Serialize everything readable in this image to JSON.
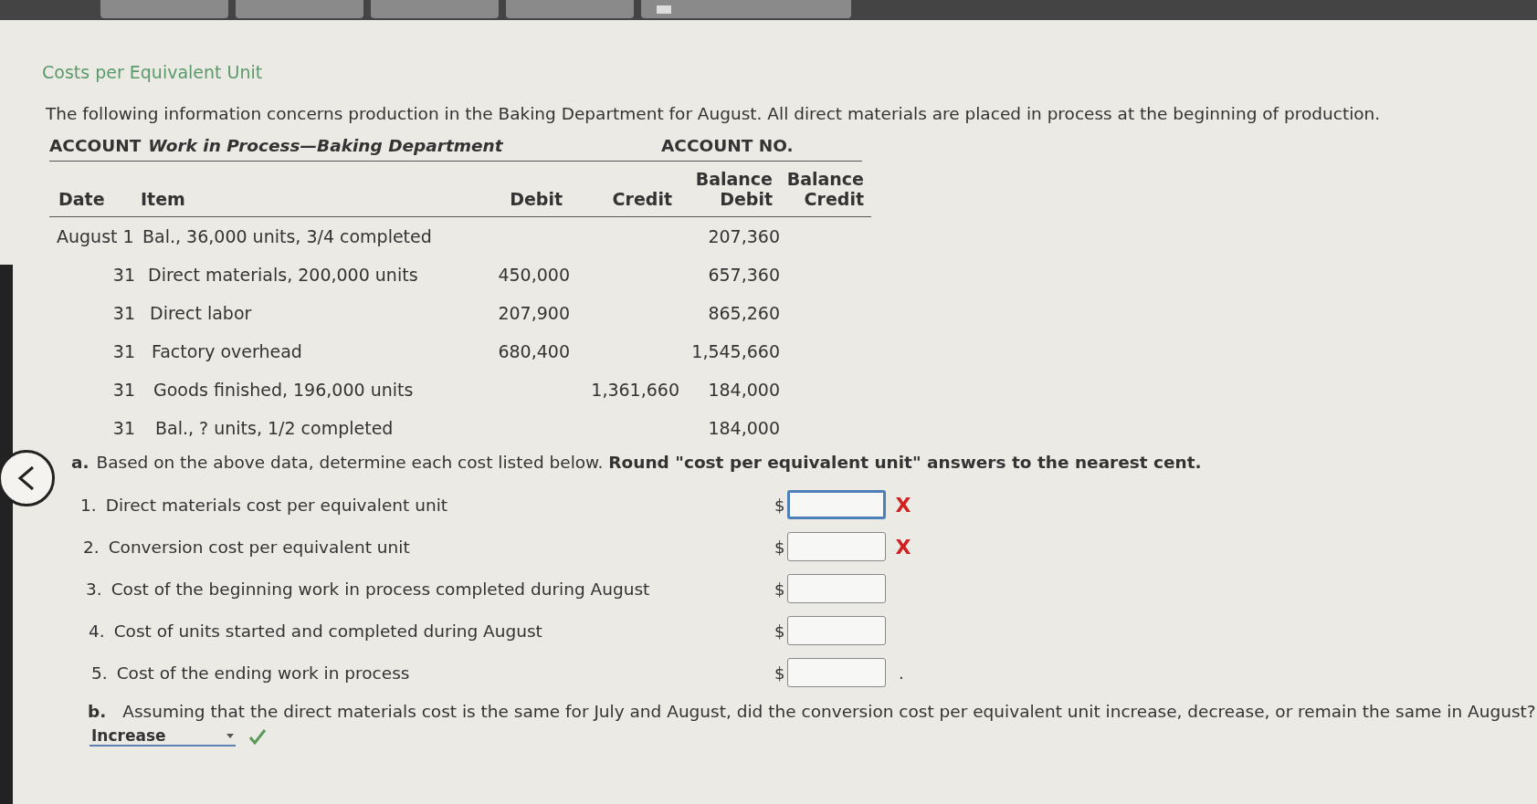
{
  "toolbar": {
    "buttons": [
      {
        "kind": "plain"
      },
      {
        "kind": "plain"
      },
      {
        "kind": "plain"
      },
      {
        "kind": "plain"
      },
      {
        "kind": "icon"
      }
    ]
  },
  "title": "Costs per Equivalent Unit",
  "intro": "The following information concerns production in the Baking Department for August. All direct materials are placed in process at the beginning of production.",
  "account": {
    "label": "ACCOUNT",
    "name": "Work in Process—Baking Department",
    "number_label": "ACCOUNT NO."
  },
  "table": {
    "columns": [
      "Date",
      "Item",
      "Debit",
      "Credit",
      "Balance Debit",
      "Balance Credit"
    ],
    "rows": [
      {
        "date": "August 1",
        "item": "Bal., 36,000 units, 3/4 completed",
        "debit": "",
        "credit": "",
        "balance_debit": "207,360"
      },
      {
        "date": "31",
        "item": "Direct materials, 200,000 units",
        "debit": "450,000",
        "credit": "",
        "balance_debit": "657,360"
      },
      {
        "date": "31",
        "item": "Direct labor",
        "debit": "207,900",
        "credit": "",
        "balance_debit": "865,260"
      },
      {
        "date": "31",
        "item": "Factory overhead",
        "debit": "680,400",
        "credit": "",
        "balance_debit": "1,545,660"
      },
      {
        "date": "31",
        "item": "Goods finished, 196,000 units",
        "debit": "",
        "credit": "1,361,660",
        "balance_debit": "184,000"
      },
      {
        "date": "31",
        "item": "Bal., ? units, 1/2 completed",
        "debit": "",
        "credit": "",
        "balance_debit": "184,000"
      }
    ]
  },
  "part_a": {
    "letter": "a.",
    "text": "Based on the above data, determine each cost listed below. **Round \"cost per equivalent unit\" answers to the nearest cent.**",
    "items": [
      {
        "number": "1.",
        "label": "Direct materials cost per equivalent unit",
        "currency": "$",
        "focused": true,
        "wrong": true,
        "mark": "X"
      },
      {
        "number": "2.",
        "label": "Conversion cost per equivalent unit",
        "currency": "$",
        "focused": false,
        "wrong": true,
        "mark": "X"
      },
      {
        "number": "3.",
        "label": "Cost of the beginning work in process completed during August",
        "currency": "$",
        "focused": false,
        "wrong": false
      },
      {
        "number": "4.",
        "label": "Cost of units started and completed during August",
        "currency": "$",
        "focused": false,
        "wrong": false
      },
      {
        "number": "5.",
        "label": "Cost of the ending work in process",
        "currency": "$",
        "focused": false,
        "wrong": false,
        "trailing": "."
      }
    ]
  },
  "part_b": {
    "letter": "b.",
    "text": "Assuming that the direct materials cost is the same for July and August, did the conversion cost per equivalent unit increase, decrease, or remain the same in August?",
    "answer": {
      "value": "Increase",
      "correct": true
    }
  }
}
